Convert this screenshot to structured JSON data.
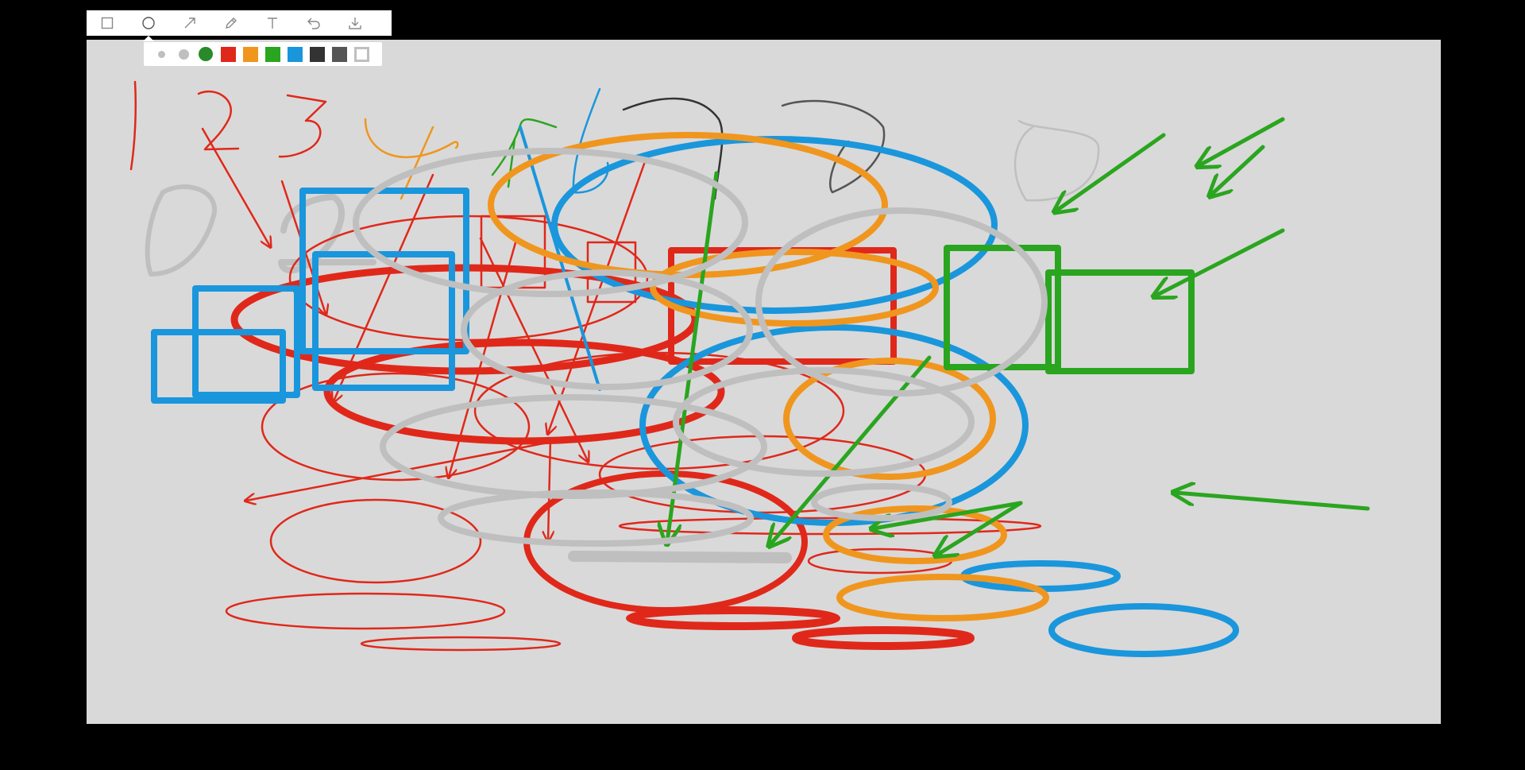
{
  "app": {
    "background": "#000000",
    "canvas_background": "#d9d9d9"
  },
  "toolbar": {
    "tools": [
      {
        "name": "rectangle",
        "icon": "rectangle-icon",
        "active": false
      },
      {
        "name": "ellipse",
        "icon": "ellipse-icon",
        "active": true
      },
      {
        "name": "arrow",
        "icon": "arrow-icon",
        "active": false
      },
      {
        "name": "pen",
        "icon": "pen-icon",
        "active": false
      },
      {
        "name": "text",
        "icon": "text-icon",
        "active": false
      },
      {
        "name": "undo",
        "icon": "undo-icon",
        "active": false
      },
      {
        "name": "download",
        "icon": "download-icon",
        "active": false
      }
    ]
  },
  "palette": {
    "sizes": [
      "small",
      "medium",
      "large"
    ],
    "colors": [
      "#e0281a",
      "#f0961e",
      "#2aa51f",
      "#1a96dc",
      "#333333",
      "#555555",
      "#ffffff"
    ],
    "selected_size": "large",
    "selected_color": "#2aa51f"
  }
}
